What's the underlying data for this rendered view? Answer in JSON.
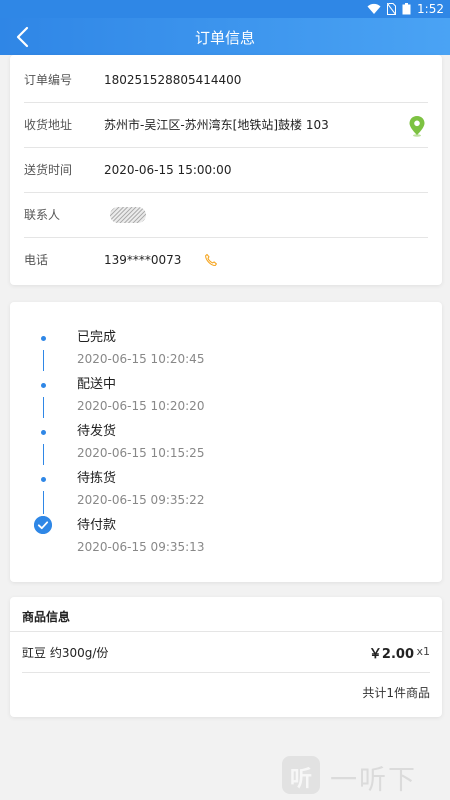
{
  "status_bar": {
    "time": "1:52"
  },
  "appbar": {
    "title": "订单信息"
  },
  "order_info": [
    {
      "label": "订单编号",
      "value": "180251528805414400"
    },
    {
      "label": "收货地址",
      "value": "苏州市-吴江区-苏州湾东[地铁站]鼓楼 103"
    },
    {
      "label": "送货时间",
      "value": "2020-06-15 15:00:00"
    },
    {
      "label": "联系人",
      "value": ""
    },
    {
      "label": "电话",
      "value": "139****0073"
    }
  ],
  "timeline": [
    {
      "status": "已完成",
      "time": "2020-06-15 10:20:45"
    },
    {
      "status": "配送中",
      "time": "2020-06-15 10:20:20"
    },
    {
      "status": "待发货",
      "time": "2020-06-15 10:15:25"
    },
    {
      "status": "待拣货",
      "time": "2020-06-15 09:35:22"
    },
    {
      "status": "待付款",
      "time": "2020-06-15 09:35:13"
    }
  ],
  "goods": {
    "header": "商品信息",
    "items": [
      {
        "name": "豇豆 约300g/份",
        "price": "￥2.00",
        "qty": "x1"
      }
    ],
    "total": "共计1件商品"
  },
  "watermark": {
    "logo": "听",
    "text": "一听下载"
  },
  "colors": {
    "primary": "#2f87e6",
    "pin": "#7dc242",
    "phone": "#f5a623"
  }
}
